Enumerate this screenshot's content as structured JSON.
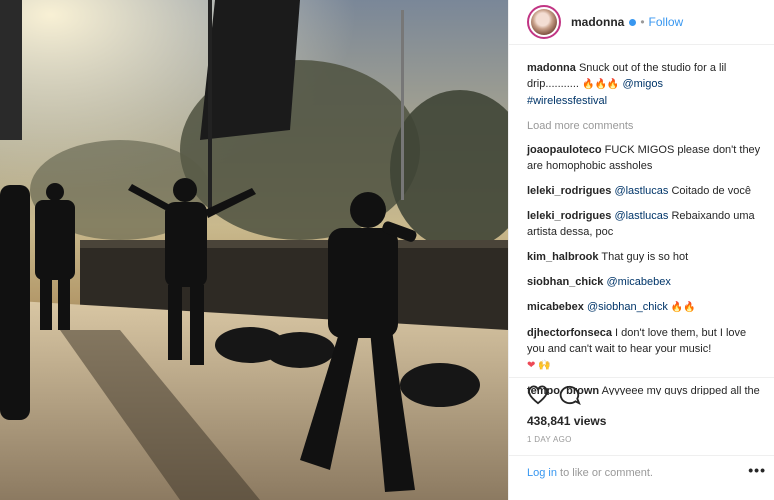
{
  "header": {
    "username": "madonna",
    "separator": "•",
    "follow_label": "Follow"
  },
  "caption": {
    "username": "madonna",
    "text": "Snuck out of the studio for a lil drip...........",
    "emojis": "🔥🔥🔥",
    "mention": "@migos",
    "hashtag": "#wirelessfestival"
  },
  "load_more": "Load more comments",
  "comments": [
    {
      "user": "joaopauloteco",
      "mention": "",
      "text": "FUCK MIGOS please don't they are homophobic assholes",
      "emoji": ""
    },
    {
      "user": "leleki_rodrigues",
      "mention": "@lastlucas",
      "text": "Coitado de você",
      "emoji": ""
    },
    {
      "user": "leleki_rodrigues",
      "mention": "@lastlucas",
      "text": "Rebaixando uma artista dessa, poc",
      "emoji": ""
    },
    {
      "user": "kim_halbrook",
      "mention": "",
      "text": "That guy is so hot",
      "emoji": ""
    },
    {
      "user": "siobhan_chick",
      "mention": "@micabebex",
      "text": "",
      "emoji": ""
    },
    {
      "user": "micabebex",
      "mention": "@siobhan_chick",
      "text": "",
      "emoji": "🔥🔥"
    },
    {
      "user": "djhectorfonseca",
      "mention": "",
      "text": "I don't love them, but I love you and can't wait to hear your music!",
      "emoji": "❤ 🙌"
    },
    {
      "user": "tempo_brown",
      "mention": "",
      "text": "Ayyyeee my guys dripped all the way",
      "emoji": ""
    }
  ],
  "icons": {
    "like": "heart-outline-icon",
    "comment": "speech-bubble-icon",
    "more": "more-options-icon"
  },
  "views": "438,841 views",
  "date": "1 DAY AGO",
  "login": {
    "link": "Log in",
    "text": " to like or comment."
  },
  "more_label": "•••",
  "colors": {
    "link_blue": "#3897f0",
    "mention_blue": "#003569",
    "muted": "#999999",
    "text": "#262626"
  }
}
